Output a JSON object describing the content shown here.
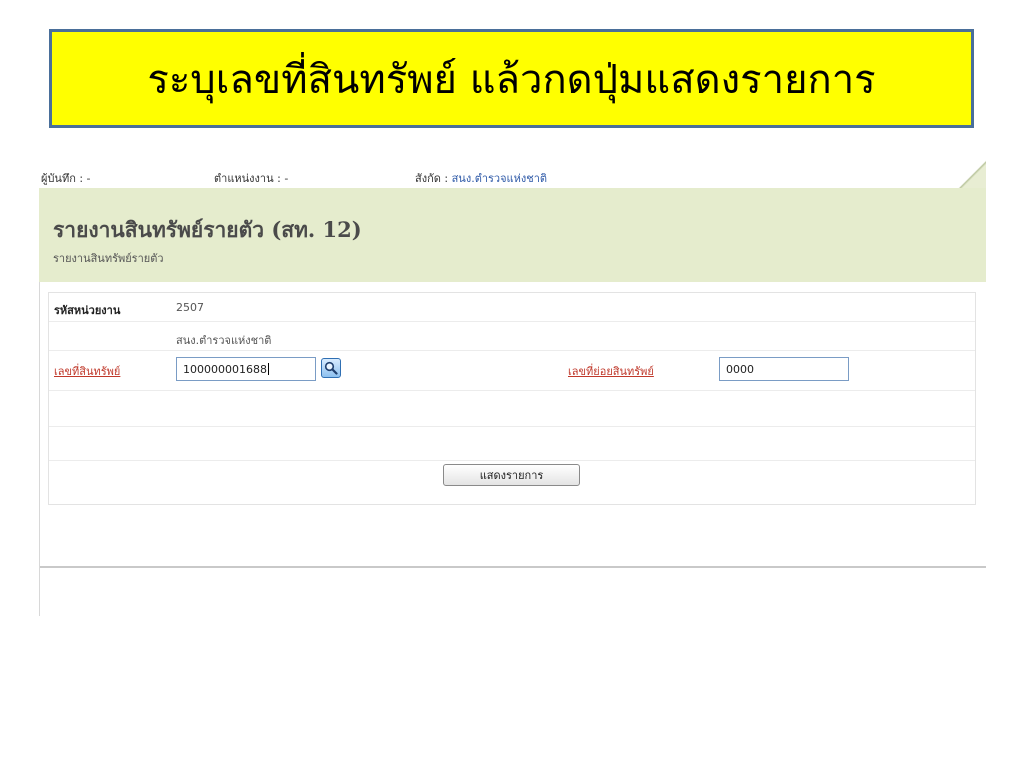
{
  "slide": {
    "instruction": "ระบุเลขที่สินทรัพย์ แล้วกดปุ่มแสดงรายการ"
  },
  "infobar": {
    "recorder_label": "ผู้บันทึก : -",
    "position_label": "ตำแหน่งงาน : -",
    "affiliation_label": "สังกัด :",
    "affiliation_value": "สนง.ตำรวจแห่งชาติ"
  },
  "header": {
    "title": "รายงานสินทรัพย์รายตัว (สท. 12)",
    "subtitle": "รายงานสินทรัพย์รายตัว"
  },
  "form": {
    "unit_code_label": "รหัสหน่วยงาน",
    "unit_code_value": "2507",
    "unit_name_value": "สนง.ตำรวจแห่งชาติ",
    "asset_no_label": "เลขที่สินทรัพย์",
    "asset_no_value": "100000001688",
    "sub_asset_no_label": "เลขที่ย่อยสินทรัพย์",
    "sub_asset_no_value": "0000",
    "show_button_label": "แสดงรายการ"
  },
  "colors": {
    "banner_bg": "#ffff00",
    "banner_border": "#4a6f9a",
    "header_bg": "#e5eccd",
    "link_red": "#c0392b"
  },
  "icons": {
    "search": "search-icon"
  }
}
